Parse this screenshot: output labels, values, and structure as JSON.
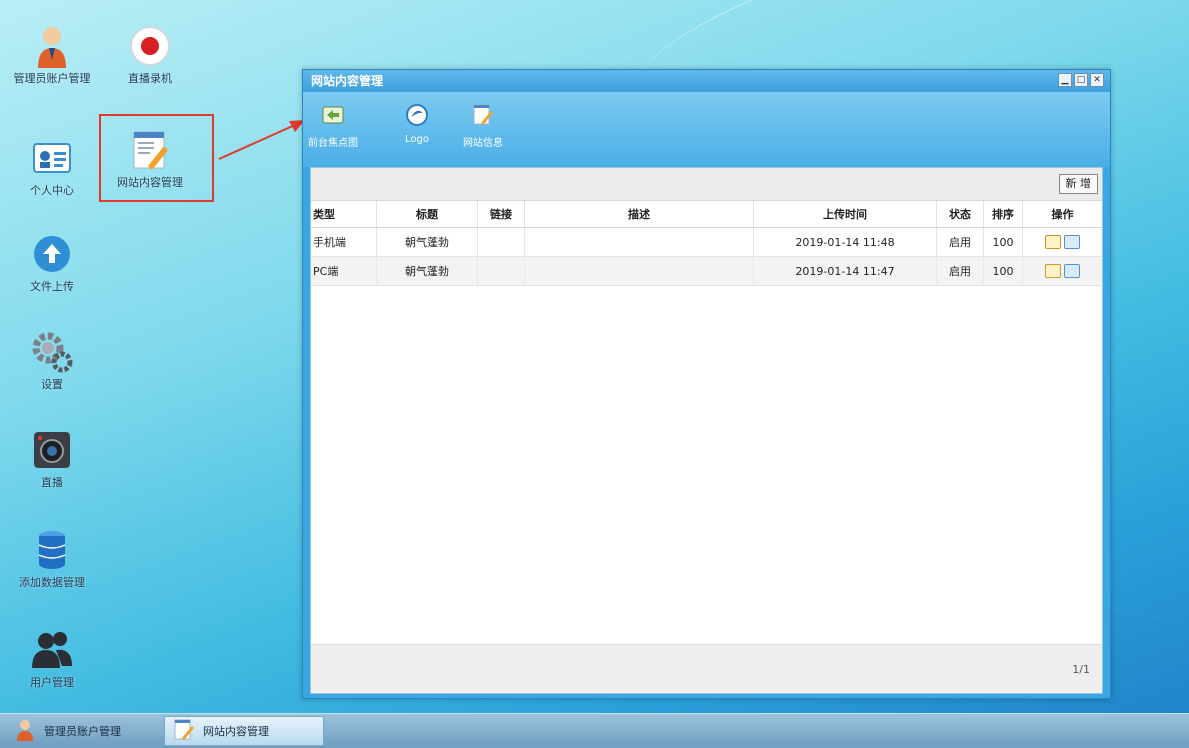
{
  "desktop": {
    "icons": [
      {
        "label": "管理员账户管理"
      },
      {
        "label": "直播录机"
      },
      {
        "label": "个人中心"
      },
      {
        "label": "网站内容管理"
      },
      {
        "label": "文件上传"
      },
      {
        "label": "设置"
      },
      {
        "label": "直播"
      },
      {
        "label": "添加数据管理"
      },
      {
        "label": "用户管理"
      }
    ]
  },
  "window": {
    "title": "网站内容管理",
    "toolbar": [
      {
        "label": "前台焦点图",
        "icon": "image-icon"
      },
      {
        "label": "Logo",
        "icon": "logo-icon"
      },
      {
        "label": "网站信息",
        "icon": "edit-icon"
      }
    ],
    "add_label": "新 增",
    "columns": [
      "类型",
      "标题",
      "链接",
      "描述",
      "上传时间",
      "状态",
      "排序",
      "操作"
    ],
    "rows": [
      {
        "type": "手机端",
        "title": "朝气蓬勃",
        "link": "",
        "desc": "",
        "time": "2019-01-14 11:48",
        "status": "启用",
        "order": "100"
      },
      {
        "type": "PC端",
        "title": "朝气蓬勃",
        "link": "",
        "desc": "",
        "time": "2019-01-14 11:47",
        "status": "启用",
        "order": "100"
      }
    ],
    "pager": "1/1"
  },
  "taskbar": {
    "items": [
      {
        "label": "管理员账户管理"
      },
      {
        "label": "网站内容管理"
      }
    ]
  },
  "colors": {
    "highlight": "#e03a2f",
    "window_blue": "#3aa7e3"
  }
}
